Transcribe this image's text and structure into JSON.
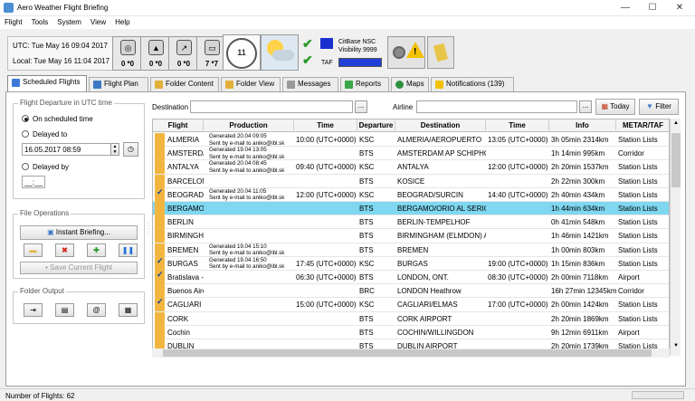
{
  "window": {
    "title": "Aero Weather Flight Briefing",
    "minimize": "—",
    "maximize": "☐",
    "close": "✕"
  },
  "menu": [
    "Flight",
    "Tools",
    "System",
    "View",
    "Help"
  ],
  "clock": {
    "utc": "UTC:  Tue May 16 09:04 2017",
    "local": "Local:  Tue May 16 11:04 2017"
  },
  "weather_counts": [
    {
      "icon": "satellite-icon",
      "label": "0 *0"
    },
    {
      "icon": "mountain-icon",
      "label": "0 *0"
    },
    {
      "icon": "route-icon",
      "label": "0 *0"
    },
    {
      "icon": "printer-icon",
      "label": "7 *7"
    }
  ],
  "gauge_value": "11",
  "citybase": {
    "name": "CitBase NSC",
    "visibility": "Visibility 9999",
    "taf": "TAF"
  },
  "tabs": [
    {
      "label": "Scheduled Flights",
      "color": "#3b7bd6"
    },
    {
      "label": "Flight Plan",
      "color": "#3a78c4"
    },
    {
      "label": "Folder Content",
      "color": "#e2b03a"
    },
    {
      "label": "Folder View",
      "color": "#e2b03a"
    },
    {
      "label": "Messages",
      "color": "#7a7a7a"
    },
    {
      "label": "Reports",
      "color": "#3aa64a"
    },
    {
      "label": "Maps",
      "color": "#2f8f3f"
    },
    {
      "label": "Notifications (139)",
      "color": "#f2c200"
    }
  ],
  "left": {
    "departure_group": "Flight Departure in UTC time",
    "on_scheduled": "On scheduled time",
    "delayed_to": "Delayed to",
    "delayed_date": "16.05.2017 08:59",
    "delayed_by": "Delayed by",
    "delayed_by_value": "__:__",
    "file_ops": "File Operations",
    "instant_briefing": "Instant Briefing...",
    "save_current": "Save Current Flight",
    "folder_output": "Folder Output"
  },
  "filters": {
    "destination_label": "Destination",
    "airline_label": "Airline",
    "dots": "...",
    "today": "Today",
    "filter": "Filter"
  },
  "grid": {
    "columns": [
      "Flight",
      "Production",
      "Time",
      "Departure",
      "Destination",
      "Time",
      "Info",
      "METAR/TAF"
    ],
    "rows": [
      {
        "flight": "ALMERIA",
        "prod1": "Generated 20.04 09:05",
        "prod2": "Sent by e-mail to aniko@ibl.sk",
        "time": "10:00 (UTC+0000)",
        "dep": "KSC",
        "dest": "ALMERIA/AEROPUERTO",
        "time2": "13:05 (UTC+0000)",
        "info": "3h 05min 2314km",
        "metar": "Station Lists",
        "check": false
      },
      {
        "flight": "AMSTERDAM",
        "prod1": "Generated 19.04 13:05",
        "prod2": "Sent by e-mail to aniko@ibl.sk",
        "time": "",
        "dep": "BTS",
        "dest": "AMSTERDAM AP SCHIPHOL",
        "time2": "",
        "info": "1h 14min 995km",
        "metar": "Corridor",
        "check": false
      },
      {
        "flight": "ANTALYA",
        "prod1": "Generated 20.04 08:45",
        "prod2": "Sent by e-mail to aniko@ibl.sk",
        "time": "09:40 (UTC+0000)",
        "dep": "KSC",
        "dest": "ANTALYA",
        "time2": "12:00 (UTC+0000)",
        "info": "2h 20min 1537km",
        "metar": "Station Lists",
        "check": false
      },
      {
        "flight": "BARCELONA",
        "prod1": "",
        "prod2": "",
        "time": "",
        "dep": "BTS",
        "dest": "KOSICE",
        "time2": "",
        "info": "2h 22min 300km",
        "metar": "Station Lists",
        "check": false
      },
      {
        "flight": "BEOGRAD",
        "prod1": "Generated 20.04 11:05",
        "prod2": "Sent by e-mail to aniko@ibl.sk",
        "time": "12:00 (UTC+0000)",
        "dep": "KSC",
        "dest": "BEOGRAD/SURCIN",
        "time2": "14:40 (UTC+0000)",
        "info": "2h 40min 434km",
        "metar": "Station Lists",
        "check": true
      },
      {
        "flight": "BERGAMO",
        "prod1": "",
        "prod2": "",
        "time": "",
        "dep": "BTS",
        "dest": "BERGAMO/ORIO AL SERIO",
        "time2": "",
        "info": "1h 44min 634km",
        "metar": "Station Lists",
        "check": false,
        "selected": true
      },
      {
        "flight": "BERLIN",
        "prod1": "",
        "prod2": "",
        "time": "",
        "dep": "BTS",
        "dest": "BERLIN-TEMPELHOF",
        "time2": "",
        "info": "0h 41min 548km",
        "metar": "Station Lists",
        "check": false
      },
      {
        "flight": "BIRMINGHAM",
        "prod1": "",
        "prod2": "",
        "time": "",
        "dep": "BTS",
        "dest": "BIRMINGHAM (ELMDON) AIR",
        "time2": "",
        "info": "1h 46min 1421km",
        "metar": "Station Lists",
        "check": false
      },
      {
        "flight": "BREMEN",
        "prod1": "Generated 19.04 15:10",
        "prod2": "Sent by e-mail to aniko@ibl.sk",
        "time": "",
        "dep": "BTS",
        "dest": "BREMEN",
        "time2": "",
        "info": "1h 00min 803km",
        "metar": "Station Lists",
        "check": false
      },
      {
        "flight": "BURGAS",
        "prod1": "Generated 19.04 16:50",
        "prod2": "Sent by e-mail to aniko@ibl.sk",
        "time": "17:45 (UTC+0000)",
        "dep": "KSC",
        "dest": "BURGAS",
        "time2": "19:00 (UTC+0000)",
        "info": "1h 15min 836km",
        "metar": "Station Lists",
        "check": true
      },
      {
        "flight": "Bratislava - L",
        "prod1": "",
        "prod2": "",
        "time": "06:30 (UTC+0000)",
        "dep": "BTS",
        "dest": "LONDON, ONT.",
        "time2": "08:30 (UTC+0000)",
        "info": "2h 00min 7118km",
        "metar": "Airport",
        "check": true
      },
      {
        "flight": "Buenos Aires",
        "prod1": "",
        "prod2": "",
        "time": "",
        "dep": "BRC",
        "dest": "LONDON Heathrow",
        "time2": "",
        "info": "16h 27min 12345km",
        "metar": "Corridor",
        "check": false
      },
      {
        "flight": "CAGLIARI",
        "prod1": "",
        "prod2": "",
        "time": "15:00 (UTC+0000)",
        "dep": "KSC",
        "dest": "CAGLIARI/ELMAS",
        "time2": "17:00 (UTC+0000)",
        "info": "2h 00min 1424km",
        "metar": "Station Lists",
        "check": true
      },
      {
        "flight": "CORK",
        "prod1": "",
        "prod2": "",
        "time": "",
        "dep": "BTS",
        "dest": "CORK AIRPORT",
        "time2": "",
        "info": "2h 20min 1869km",
        "metar": "Station Lists",
        "check": false
      },
      {
        "flight": "Cochin",
        "prod1": "",
        "prod2": "",
        "time": "",
        "dep": "BTS",
        "dest": "COCHIN/WILLINGDON",
        "time2": "",
        "info": "9h 12min 6911km",
        "metar": "Airport",
        "check": false
      },
      {
        "flight": "DUBLIN",
        "prod1": "",
        "prod2": "",
        "time": "",
        "dep": "BTS",
        "dest": "DUBLIN AIRPORT",
        "time2": "",
        "info": "2h 20min 1739km",
        "metar": "Station Lists",
        "check": false
      }
    ]
  },
  "status": "Number of Flights: 62"
}
